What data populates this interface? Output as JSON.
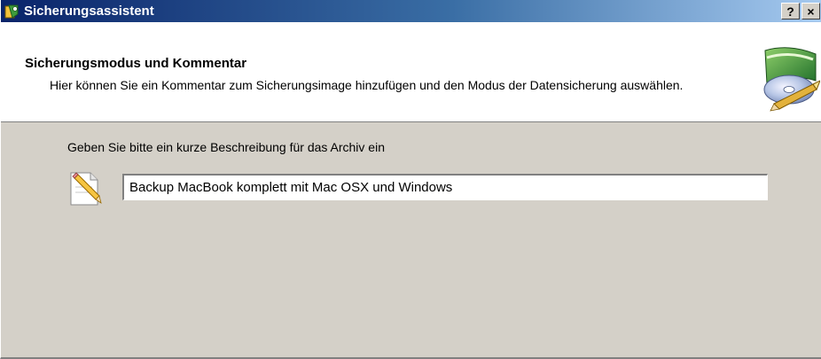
{
  "window": {
    "title": "Sicherungsassistent",
    "help_label": "?",
    "close_label": "×"
  },
  "header": {
    "title": "Sicherungsmodus und Kommentar",
    "description": "Hier können Sie ein Kommentar zum Sicherungsimage hinzufügen und den Modus der Datensicherung auswählen.",
    "graphic_icon": "backup-disk-icon"
  },
  "form": {
    "prompt": "Geben Sie bitte ein kurze Beschreibung für das Archiv ein",
    "input_value": "Backup MacBook komplett mit Mac OSX und Windows",
    "input_icon": "pencil-note-icon"
  },
  "colors": {
    "title_start": "#0a246a",
    "title_end": "#a6caf0",
    "dialog_bg": "#d4d0c8"
  }
}
